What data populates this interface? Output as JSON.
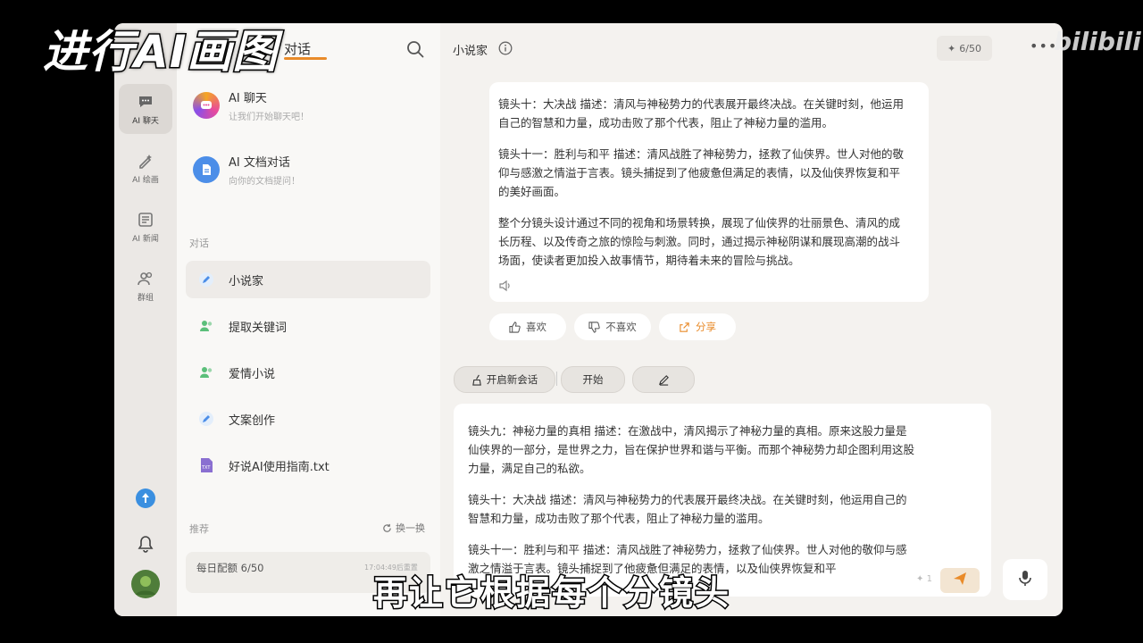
{
  "overlay": {
    "title": "进行AI画图",
    "subtitle": "再让它根据每个分镜头",
    "watermark": "bilibili"
  },
  "rail": {
    "items": [
      {
        "label": "AI 聊天",
        "icon": "chat-icon",
        "active": true
      },
      {
        "label": "AI 绘画",
        "icon": "paint-icon",
        "active": false
      },
      {
        "label": "AI 新闻",
        "icon": "news-icon",
        "active": false
      },
      {
        "label": "群组",
        "icon": "group-icon",
        "active": false
      }
    ],
    "bottom_icons": [
      "upload-icon",
      "bell-icon",
      "avatar"
    ]
  },
  "panel": {
    "title": "对话",
    "features": [
      {
        "title": "AI 聊天",
        "desc": "让我们开始聊天吧！",
        "color": "#e84a9c"
      },
      {
        "title": "AI 文档对话",
        "desc": "向你的文档提问！",
        "color": "#4c8ee8"
      }
    ],
    "section_label": "对话",
    "conversations": [
      {
        "label": "小说家",
        "icon": "pen-icon",
        "active": true
      },
      {
        "label": "提取关键词",
        "icon": "users-icon",
        "active": false
      },
      {
        "label": "爱情小说",
        "icon": "users-icon",
        "active": false
      },
      {
        "label": "文案创作",
        "icon": "pen-icon",
        "active": false
      },
      {
        "label": "好说AI使用指南.txt",
        "icon": "txt-file-icon",
        "active": false
      }
    ],
    "recommend_label": "推荐",
    "refresh_label": "换一换",
    "quota_label": "每日配额 6/50",
    "quota_time": "17:04:49后重置"
  },
  "main": {
    "title": "小说家",
    "quota_pill": "6/50",
    "message1": [
      "镜头十：大决战 描述：清风与神秘势力的代表展开最终决战。在关键时刻，他运用自己的智慧和力量，成功击败了那个代表，阻止了神秘力量的滥用。",
      "镜头十一：胜利与和平 描述：清风战胜了神秘势力，拯救了仙侠界。世人对他的敬仰与感激之情溢于言表。镜头捕捉到了他疲惫但满足的表情，以及仙侠界恢复和平的美好画面。",
      "整个分镜头设计通过不同的视角和场景转换，展现了仙侠界的壮丽景色、清风的成长历程、以及传奇之旅的惊险与刺激。同时，通过揭示神秘阴谋和展现高潮的战斗场面，使读者更加投入故事情节，期待着未来的冒险与挑战。"
    ],
    "actions": [
      {
        "label": "喜欢",
        "icon": "thumb-up-icon",
        "color": "#555"
      },
      {
        "label": "不喜欢",
        "icon": "thumb-down-icon",
        "color": "#555"
      },
      {
        "label": "分享",
        "icon": "share-icon",
        "color": "#e98b2a"
      }
    ],
    "chips": {
      "new_session": "开启新会话",
      "start": "开始"
    },
    "input_paragraphs": [
      "镜头九：神秘力量的真相 描述：在激战中，清风揭示了神秘力量的真相。原来这股力量是仙侠界的一部分，是世界之力，旨在保护世界和谐与平衡。而那个神秘势力却企图利用这股力量，满足自己的私欲。",
      "镜头十：大决战 描述：清风与神秘势力的代表展开最终决战。在关键时刻，他运用自己的智慧和力量，成功击败了那个代表，阻止了神秘力量的滥用。",
      "镜头十一：胜利与和平 描述：清风战胜了神秘势力，拯救了仙侠界。世人对他的敬仰与感激之情溢于言表。镜头捕捉到了他疲惫但满足的表情，以及仙侠界恢复和平"
    ],
    "counter": "1"
  }
}
